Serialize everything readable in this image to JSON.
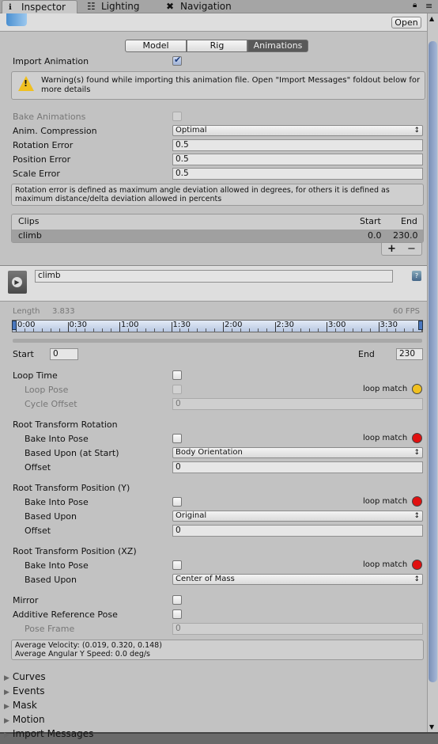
{
  "tabs": [
    {
      "label": "Inspector",
      "icon": "info-icon"
    },
    {
      "label": "Lighting",
      "icon": "lighting-icon"
    },
    {
      "label": "Navigation",
      "icon": "navigation-icon"
    }
  ],
  "header": {
    "open_label": "Open"
  },
  "segments": {
    "items": [
      "Model",
      "Rig",
      "Animations"
    ],
    "selected": "Animations"
  },
  "import_animation": {
    "label": "Import Animation",
    "checked": true
  },
  "warning": {
    "text": "Warning(s) found while importing this animation file. Open \"Import Messages\" foldout below for more details"
  },
  "settings": [
    {
      "label": "Bake Animations",
      "type": "checkbox",
      "disabled": true
    },
    {
      "label": "Anim. Compression",
      "type": "dropdown",
      "value": "Optimal"
    },
    {
      "label": "Rotation Error",
      "type": "input",
      "value": "0.5"
    },
    {
      "label": "Position Error",
      "type": "input",
      "value": "0.5"
    },
    {
      "label": "Scale Error",
      "type": "input",
      "value": "0.5"
    }
  ],
  "help_text": "Rotation error is defined as maximum angle deviation allowed in degrees, for others it is defined as maximum distance/delta deviation allowed in percents",
  "clips": {
    "headers": [
      "Clips",
      "Start",
      "End"
    ],
    "rows": [
      {
        "name": "climb",
        "start": "0.0",
        "end": "230.0"
      }
    ],
    "add": "+",
    "remove": "−"
  },
  "clip": {
    "name": "climb",
    "length_label": "Length",
    "length": "3.833",
    "fps": "60 FPS",
    "timeline_ticks": [
      "0:00",
      "0:30",
      "1:00",
      "1:30",
      "2:00",
      "2:30",
      "3:00",
      "3:30"
    ],
    "start_label": "Start",
    "start": "0",
    "end_label": "End",
    "end": "230"
  },
  "loop_match_label": "loop match",
  "colors": {
    "loop_match_yellow": "#f0c020",
    "loop_match_red": "#e01010"
  },
  "rows": [
    {
      "label": "Loop Time",
      "type": "checkbox"
    },
    {
      "label": "Loop Pose",
      "type": "checkbox",
      "indent": true,
      "disabled": true,
      "match": "yellow"
    },
    {
      "label": "Cycle Offset",
      "type": "input",
      "value": "0",
      "indent": true,
      "disabled": true
    },
    {
      "label": "Root Transform Rotation",
      "type": "header"
    },
    {
      "label": "Bake Into Pose",
      "type": "checkbox",
      "indent": true,
      "match": "red"
    },
    {
      "label": "Based Upon (at Start)",
      "type": "dropdown",
      "value": "Body Orientation",
      "indent": true
    },
    {
      "label": "Offset",
      "type": "input",
      "value": "0",
      "indent": true
    },
    {
      "label": "Root Transform Position (Y)",
      "type": "header"
    },
    {
      "label": "Bake Into Pose",
      "type": "checkbox",
      "indent": true,
      "match": "red"
    },
    {
      "label": "Based Upon",
      "type": "dropdown",
      "value": "Original",
      "indent": true
    },
    {
      "label": "Offset",
      "type": "input",
      "value": "0",
      "indent": true
    },
    {
      "label": "Root Transform Position (XZ)",
      "type": "header"
    },
    {
      "label": "Bake Into Pose",
      "type": "checkbox",
      "indent": true,
      "match": "red"
    },
    {
      "label": "Based Upon",
      "type": "dropdown",
      "value": "Center of Mass",
      "indent": true
    },
    {
      "label": "Mirror",
      "type": "checkbox",
      "gap": true
    },
    {
      "label": "Additive Reference Pose",
      "type": "checkbox"
    },
    {
      "label": "Pose Frame",
      "type": "input",
      "value": "0",
      "indent": true,
      "disabled": true
    }
  ],
  "stats": {
    "velocity": "Average Velocity: (0.019, 0.320, 0.148)",
    "angular": "Average Angular Y Speed: 0.0 deg/s"
  },
  "foldouts": [
    "Curves",
    "Events",
    "Mask",
    "Motion",
    "Import Messages"
  ]
}
